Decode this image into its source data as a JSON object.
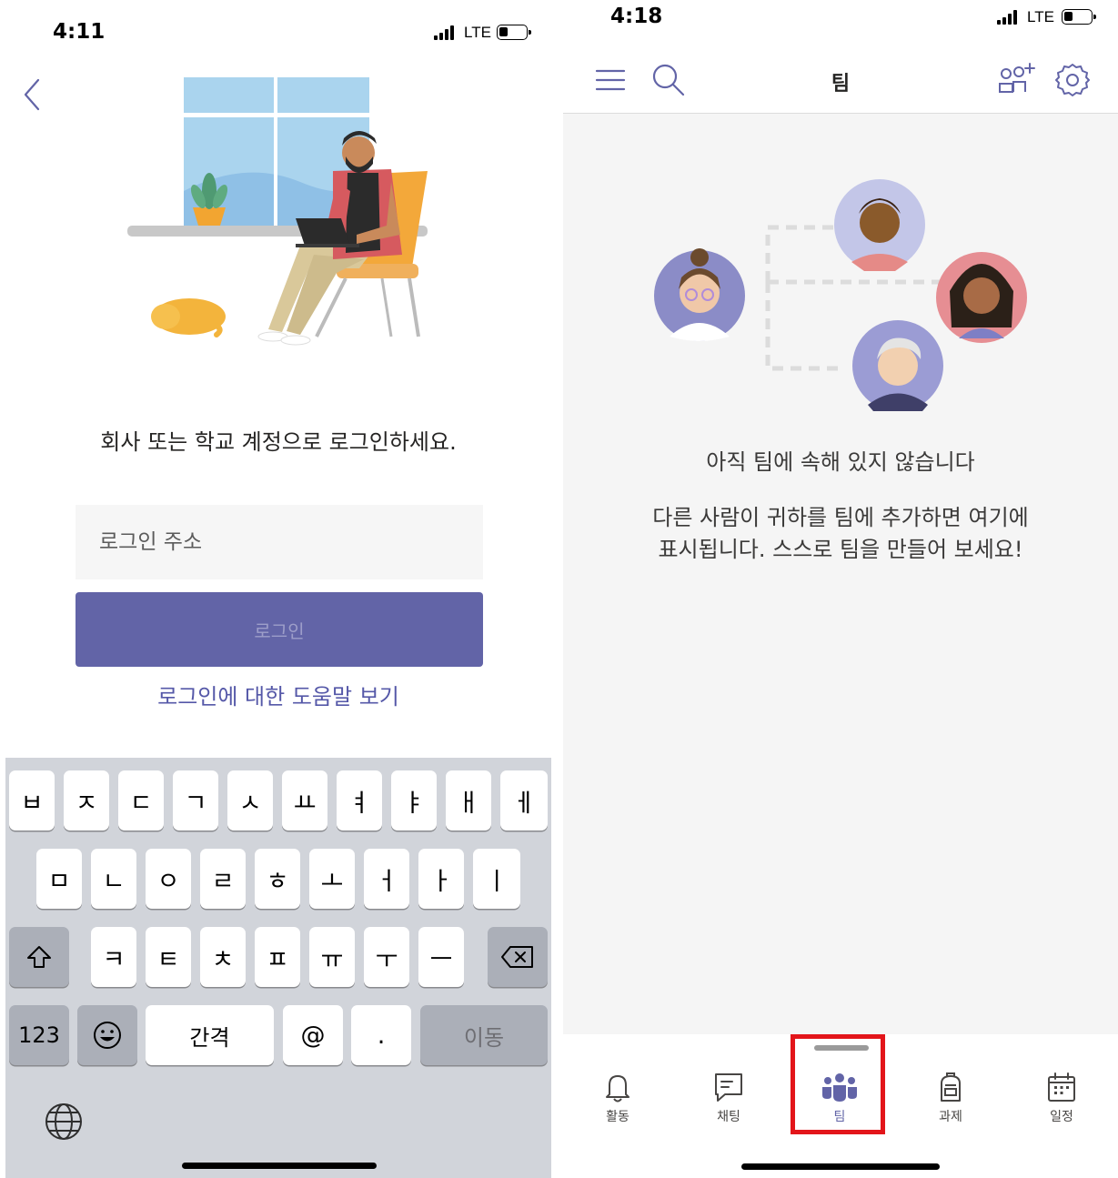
{
  "left_screen": {
    "status_bar": {
      "time": "4:11",
      "network": "LTE"
    },
    "prompt": "회사 또는 학교 계정으로 로그인하세요.",
    "login_input": {
      "placeholder": "로그인 주소",
      "value": ""
    },
    "login_button_label": "로그인",
    "help_link": "로그인에 대한 도움말 보기",
    "keyboard": {
      "row1": [
        "ㅂ",
        "ㅈ",
        "ㄷ",
        "ㄱ",
        "ㅅ",
        "ㅛ",
        "ㅕ",
        "ㅑ",
        "ㅐ",
        "ㅔ"
      ],
      "row2": [
        "ㅁ",
        "ㄴ",
        "ㅇ",
        "ㄹ",
        "ㅎ",
        "ㅗ",
        "ㅓ",
        "ㅏ",
        "ㅣ"
      ],
      "row3": [
        "ㅋ",
        "ㅌ",
        "ㅊ",
        "ㅍ",
        "ㅠ",
        "ㅜ",
        "ㅡ"
      ],
      "numbers_key": "123",
      "space_key": "간격",
      "at_key": "@",
      "period_key": ".",
      "go_key": "이동"
    }
  },
  "right_screen": {
    "status_bar": {
      "time": "4:18",
      "network": "LTE"
    },
    "header_title": "팀",
    "empty_title": "아직 팀에 속해 있지 않습니다",
    "empty_desc_line1": "다른 사람이 귀하를 팀에 추가하면 여기에",
    "empty_desc_line2": "표시됩니다. 스스로 팀을 만들어 보세요!",
    "tabs": [
      {
        "label": "활동",
        "icon": "bell-icon"
      },
      {
        "label": "채팅",
        "icon": "chat-icon"
      },
      {
        "label": "팀",
        "icon": "teams-icon"
      },
      {
        "label": "과제",
        "icon": "backpack-icon"
      },
      {
        "label": "일정",
        "icon": "calendar-icon"
      }
    ],
    "active_tab_index": 2
  },
  "colors": {
    "brand": "#6264a7",
    "highlight": "#e3151a",
    "link": "#5558a8"
  }
}
